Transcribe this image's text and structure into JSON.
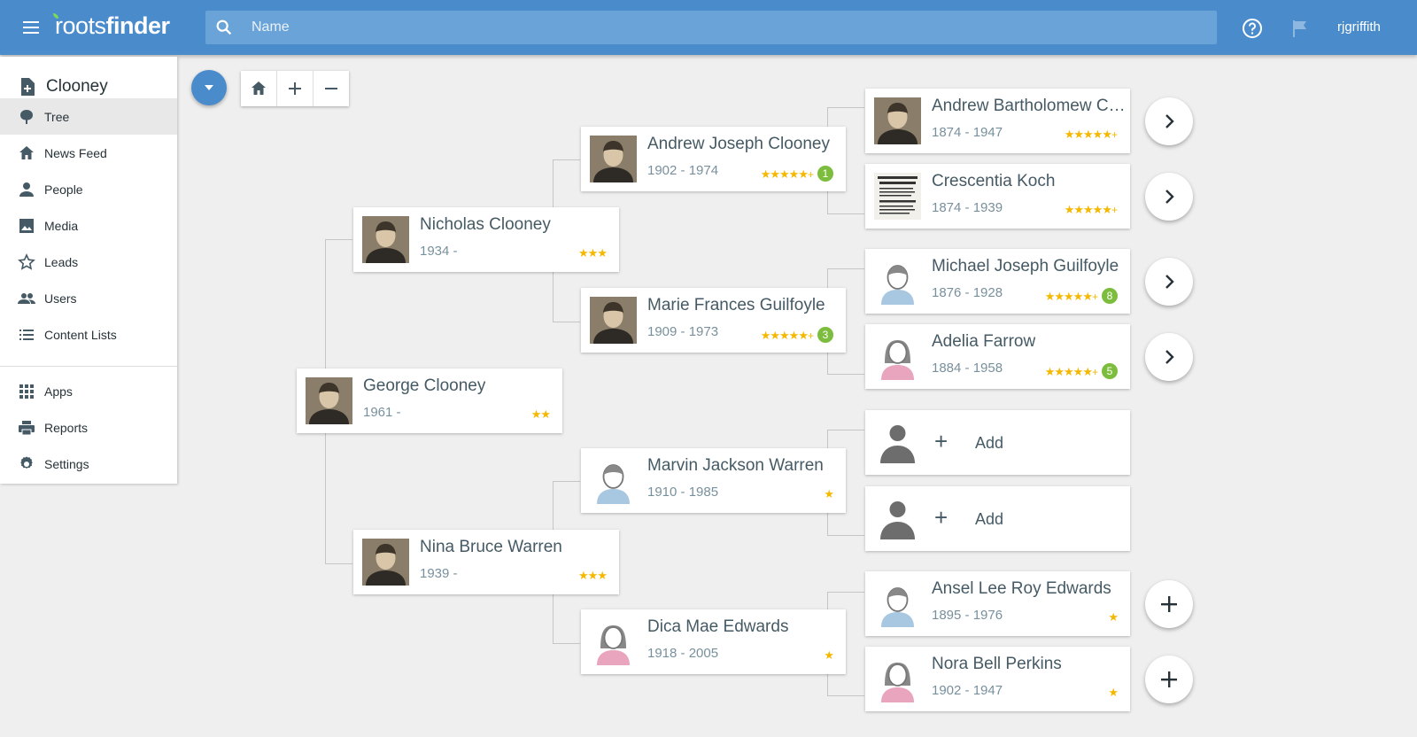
{
  "app": {
    "logo_light": "roots",
    "logo_bold": "finder"
  },
  "search": {
    "placeholder": "Name"
  },
  "user": {
    "name": "rjgriffith"
  },
  "sidebar": {
    "tree_name": "Clooney",
    "items": [
      {
        "label": "Tree",
        "icon": "tree-icon"
      },
      {
        "label": "News Feed",
        "icon": "home-icon"
      },
      {
        "label": "People",
        "icon": "person-icon"
      },
      {
        "label": "Media",
        "icon": "image-icon"
      },
      {
        "label": "Leads",
        "icon": "star-outline-icon"
      },
      {
        "label": "Users",
        "icon": "users-icon"
      },
      {
        "label": "Content Lists",
        "icon": "list-icon"
      },
      {
        "label": "Apps",
        "icon": "apps-grid-icon"
      },
      {
        "label": "Reports",
        "icon": "printer-icon"
      },
      {
        "label": "Settings",
        "icon": "gear-icon"
      }
    ]
  },
  "tree": {
    "people": [
      {
        "name": "George Clooney",
        "dates": "1961 -",
        "stars": "★★",
        "badge": "",
        "photo": "photo"
      },
      {
        "name": "Nicholas Clooney",
        "dates": "1934 -",
        "stars": "★★★",
        "badge": "",
        "photo": "photo"
      },
      {
        "name": "Nina Bruce Warren",
        "dates": "1939 -",
        "stars": "★★★",
        "badge": "",
        "photo": "photo"
      },
      {
        "name": "Andrew Joseph Clooney",
        "dates": "1902 - 1974",
        "stars": "★★★★★",
        "badge": "1",
        "photo": "photo"
      },
      {
        "name": "Marie Frances Guilfoyle",
        "dates": "1909 - 1973",
        "stars": "★★★★★",
        "badge": "3",
        "photo": "photo"
      },
      {
        "name": "Marvin Jackson Warren",
        "dates": "1910 - 1985",
        "stars": "★",
        "badge": "",
        "photo": "male"
      },
      {
        "name": "Dica Mae Edwards",
        "dates": "1918 - 2005",
        "stars": "★",
        "badge": "",
        "photo": "female"
      },
      {
        "name": "Andrew Bartholomew Clo...",
        "dates": "1874 - 1947",
        "stars": "★★★★★",
        "badge": "",
        "photo": "photo"
      },
      {
        "name": "Crescentia Koch",
        "dates": "1874 - 1939",
        "stars": "★★★★★",
        "badge": "",
        "photo": "document"
      },
      {
        "name": "Michael Joseph Guilfoyle",
        "dates": "1876 - 1928",
        "stars": "★★★★★",
        "badge": "8",
        "photo": "male"
      },
      {
        "name": "Adelia Farrow",
        "dates": "1884 - 1958",
        "stars": "★★★★★",
        "badge": "5",
        "photo": "female"
      },
      {
        "name": "Ansel Lee Roy Edwards",
        "dates": "1895 - 1976",
        "stars": "★",
        "badge": "",
        "photo": "male"
      },
      {
        "name": "Nora Bell Perkins",
        "dates": "1902 - 1947",
        "stars": "★",
        "badge": "",
        "photo": "female"
      }
    ],
    "add_label": "Add",
    "plus_marker": "+"
  },
  "colors": {
    "brand": "#4a8ccb",
    "star": "#f5b800",
    "badge": "#7cbd3e",
    "male": "#a8c8e1",
    "female": "#e8a5bd"
  }
}
